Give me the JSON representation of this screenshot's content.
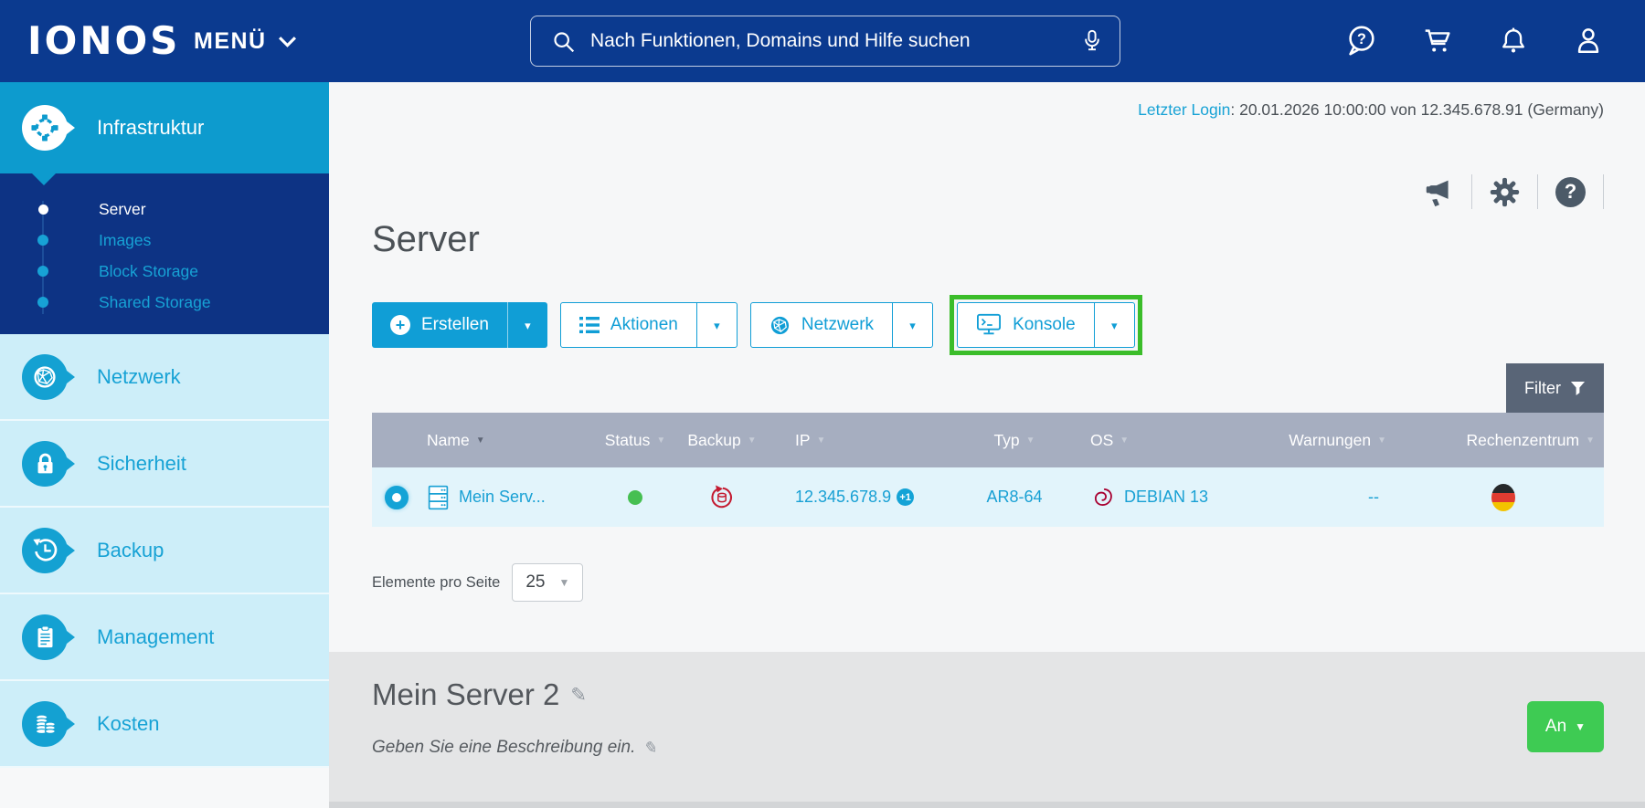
{
  "topbar": {
    "logo": "IONOS",
    "menu_label": "MENÜ",
    "search_placeholder": "Nach Funktionen, Domains und Hilfe suchen",
    "icons": [
      "help-chat-icon",
      "cart-icon",
      "bell-icon",
      "account-icon"
    ]
  },
  "sidebar": {
    "items": [
      {
        "label": "Infrastruktur",
        "active": true,
        "icon": "infrastructure-icon"
      },
      {
        "label": "Netzwerk",
        "icon": "network-icon"
      },
      {
        "label": "Sicherheit",
        "icon": "lock-icon"
      },
      {
        "label": "Backup",
        "icon": "backup-history-icon"
      },
      {
        "label": "Management",
        "icon": "clipboard-icon"
      },
      {
        "label": "Kosten",
        "icon": "coins-icon"
      }
    ],
    "submenu": [
      {
        "label": "Server",
        "active": true
      },
      {
        "label": "Images"
      },
      {
        "label": "Block Storage"
      },
      {
        "label": "Shared Storage"
      }
    ]
  },
  "status_bar": {
    "last_login_label": "Letzter Login",
    "last_login_rest": ": 20.01.2026 10:00:00 von 12.345.678.91 (Germany)"
  },
  "util_icons": [
    "megaphone-icon",
    "gear-icon",
    "help-circle-icon"
  ],
  "page": {
    "title": "Server"
  },
  "toolbar": {
    "create": "Erstellen",
    "actions": "Aktionen",
    "network": "Netzwerk",
    "console": "Konsole",
    "filter": "Filter",
    "console_highlighted": true
  },
  "server_table": {
    "columns": [
      "Name",
      "Status",
      "Backup",
      "IP",
      "Typ",
      "OS",
      "Warnungen",
      "Rechenzentrum"
    ],
    "sorted_by": "Name",
    "row": {
      "selected": true,
      "name": "Mein Serv...",
      "status": "ok",
      "backup_icon": "backup-active-icon",
      "ip": "12.345.678.9",
      "ip_extra": "+1",
      "typ": "AR8-64",
      "os": "DEBIAN 13",
      "os_icon": "debian-icon",
      "warnings": "--",
      "datacenter_flag": "germany"
    }
  },
  "pagination": {
    "label": "Elemente pro Seite",
    "per_page": "25"
  },
  "detail": {
    "title": "Mein Server 2",
    "description_placeholder": "Geben Sie eine Beschreibung ein.",
    "power_state": "An"
  },
  "colors": {
    "header_navy": "#0b3a8f",
    "submenu_navy": "#0d3384",
    "accent_cyan": "#109ed6",
    "sidebar_active_cyan": "#0d9bce",
    "sidebar_light": "#cdeef9",
    "table_header_gray": "#a6aec0",
    "filter_slate": "#596577",
    "row_light_blue": "#e2f4fb",
    "status_green": "#46bf51",
    "backup_red": "#c41a30",
    "debian_red": "#a80030",
    "highlight_green": "#3bbd2a",
    "power_green": "#3ecb53"
  }
}
